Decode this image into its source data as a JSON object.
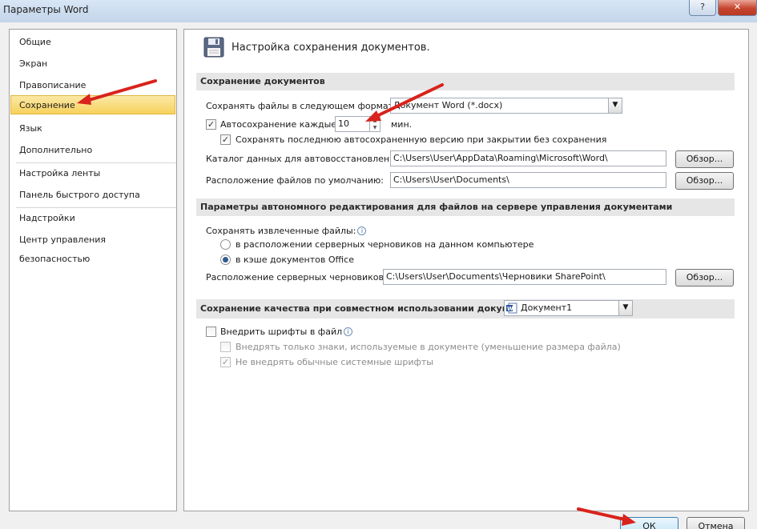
{
  "window": {
    "title": "Параметры Word",
    "help_label": "?",
    "close_label": "✕"
  },
  "nav": {
    "items": [
      {
        "label": "Общие"
      },
      {
        "label": "Экран"
      },
      {
        "label": "Правописание"
      },
      {
        "label": "Сохранение",
        "active": true
      },
      {
        "label": "Язык"
      },
      {
        "label": "Дополнительно"
      },
      {
        "label": "Настройка ленты"
      },
      {
        "label": "Панель быстрого доступа"
      },
      {
        "label": "Надстройки"
      },
      {
        "label": "Центр управления безопасностью"
      }
    ]
  },
  "header": {
    "icon": "floppy-disk-icon",
    "title": "Настройка сохранения документов."
  },
  "save_docs": {
    "section_title": "Сохранение документов",
    "format_label": "Сохранять файлы в следующем формате:",
    "format_value": "Документ Word (*.docx)",
    "autosave_label": "Автосохранение каждые",
    "autosave_checked": true,
    "autosave_minutes": "10",
    "minutes_unit": "мин.",
    "keep_last_label": "Сохранять последнюю автосохраненную версию при закрытии без сохранения",
    "keep_last_checked": true,
    "autorecover_label": "Каталог данных для автовосстановления:",
    "autorecover_path": "C:\\Users\\User\\AppData\\Roaming\\Microsoft\\Word\\",
    "default_location_label": "Расположение файлов по умолчанию:",
    "default_location_path": "C:\\Users\\User\\Documents\\",
    "browse_label": "Обзор..."
  },
  "offline": {
    "section_title": "Параметры автономного редактирования для файлов на сервере управления документами",
    "save_checked_out_label": "Сохранять извлеченные файлы:",
    "option1_label": "в расположении серверных черновиков на данном компьютере",
    "option1_selected": false,
    "option2_label": "в кэше документов Office",
    "option2_selected": true,
    "drafts_location_label": "Расположение серверных черновиков:",
    "drafts_location_path": "C:\\Users\\User\\Documents\\Черновики SharePoint\\",
    "browse_label": "Обзор..."
  },
  "fidelity": {
    "section_title": "Сохранение качества при совместном использовании документа:",
    "document_value": "Документ1",
    "document_icon": "word-document-icon",
    "embed_fonts_label": "Внедрить шрифты в файл",
    "embed_fonts_checked": false,
    "embed_used_only_label": "Внедрять только знаки, используемые в документе (уменьшение размера файла)",
    "embed_used_only_checked": false,
    "no_common_fonts_label": "Не внедрять обычные системные шрифты",
    "no_common_fonts_checked": true
  },
  "footer": {
    "ok_label": "ОК",
    "cancel_label": "Отмена"
  },
  "colors": {
    "annotation_arrow": "#d9231c",
    "active_nav": "#f7d15c",
    "section_bg": "#e6e6e6"
  }
}
